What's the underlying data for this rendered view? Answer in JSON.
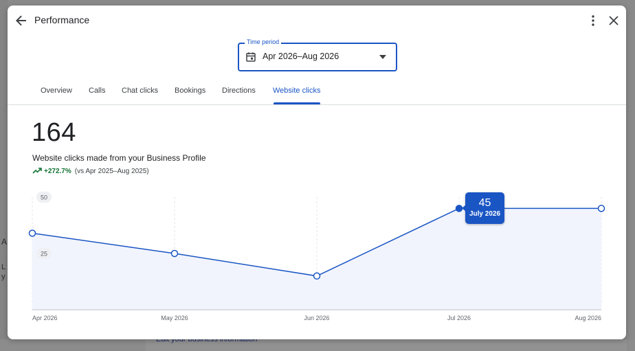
{
  "dialog": {
    "title": "Performance"
  },
  "time_period": {
    "label": "Time period",
    "value": "Apr 2026–Aug 2026"
  },
  "tabs": [
    {
      "label": "Overview",
      "active": false
    },
    {
      "label": "Calls",
      "active": false
    },
    {
      "label": "Chat clicks",
      "active": false
    },
    {
      "label": "Bookings",
      "active": false
    },
    {
      "label": "Directions",
      "active": false
    },
    {
      "label": "Website clicks",
      "active": true
    }
  ],
  "metric": {
    "value": "164",
    "description": "Website clicks made from your Business Profile",
    "change": "+272.7%",
    "comparison": "(vs Apr 2025–Aug 2025)"
  },
  "tooltip": {
    "value": "45",
    "date": "July 2026"
  },
  "background": {
    "link_text": "Edit your business information",
    "fragment_a": "A",
    "fragment_l1": "L",
    "fragment_l2": "y"
  },
  "colors": {
    "accent": "#1a55c4",
    "positive": "#137333",
    "area_fill": "#f1f4fd"
  },
  "chart_data": {
    "type": "line",
    "categories": [
      "Apr 2026",
      "May 2026",
      "Jun 2026",
      "Jul 2026",
      "Aug 2026"
    ],
    "values": [
      34,
      25,
      15,
      45,
      45
    ],
    "y_ticks": [
      "25",
      "50"
    ],
    "ylim": [
      0,
      50
    ],
    "grid": true,
    "highlighted_index": 3
  }
}
